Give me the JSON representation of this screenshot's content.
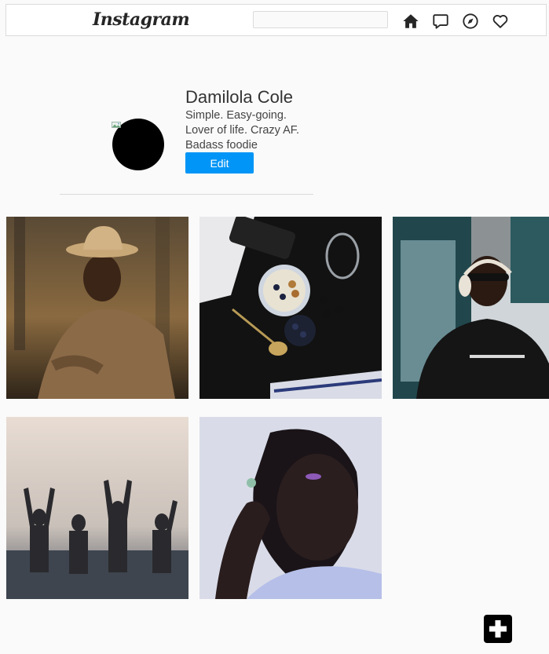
{
  "app": {
    "logo": "Instagram"
  },
  "search": {
    "value": "",
    "placeholder": ""
  },
  "nav": [
    {
      "icon": "home-icon"
    },
    {
      "icon": "messages-icon"
    },
    {
      "icon": "explore-compass-icon"
    },
    {
      "icon": "activity-heart-icon"
    }
  ],
  "profile": {
    "name": "Damilola Cole",
    "bio_lines": [
      "Simple. Easy-going.",
      "Lover of life. Crazy AF.",
      "Badass foodie"
    ],
    "edit_label": "Edit"
  },
  "posts": [
    {
      "icon": "photo-man-in-hat"
    },
    {
      "icon": "photo-food-bowl-table"
    },
    {
      "icon": "photo-man-with-headphones"
    },
    {
      "icon": "photo-people-splashing-sea"
    },
    {
      "icon": "photo-woman-portrait"
    }
  ],
  "colors": {
    "accent": "#0095f6",
    "background": "#fafafa"
  },
  "fab": {
    "icon": "add-plus-icon"
  }
}
